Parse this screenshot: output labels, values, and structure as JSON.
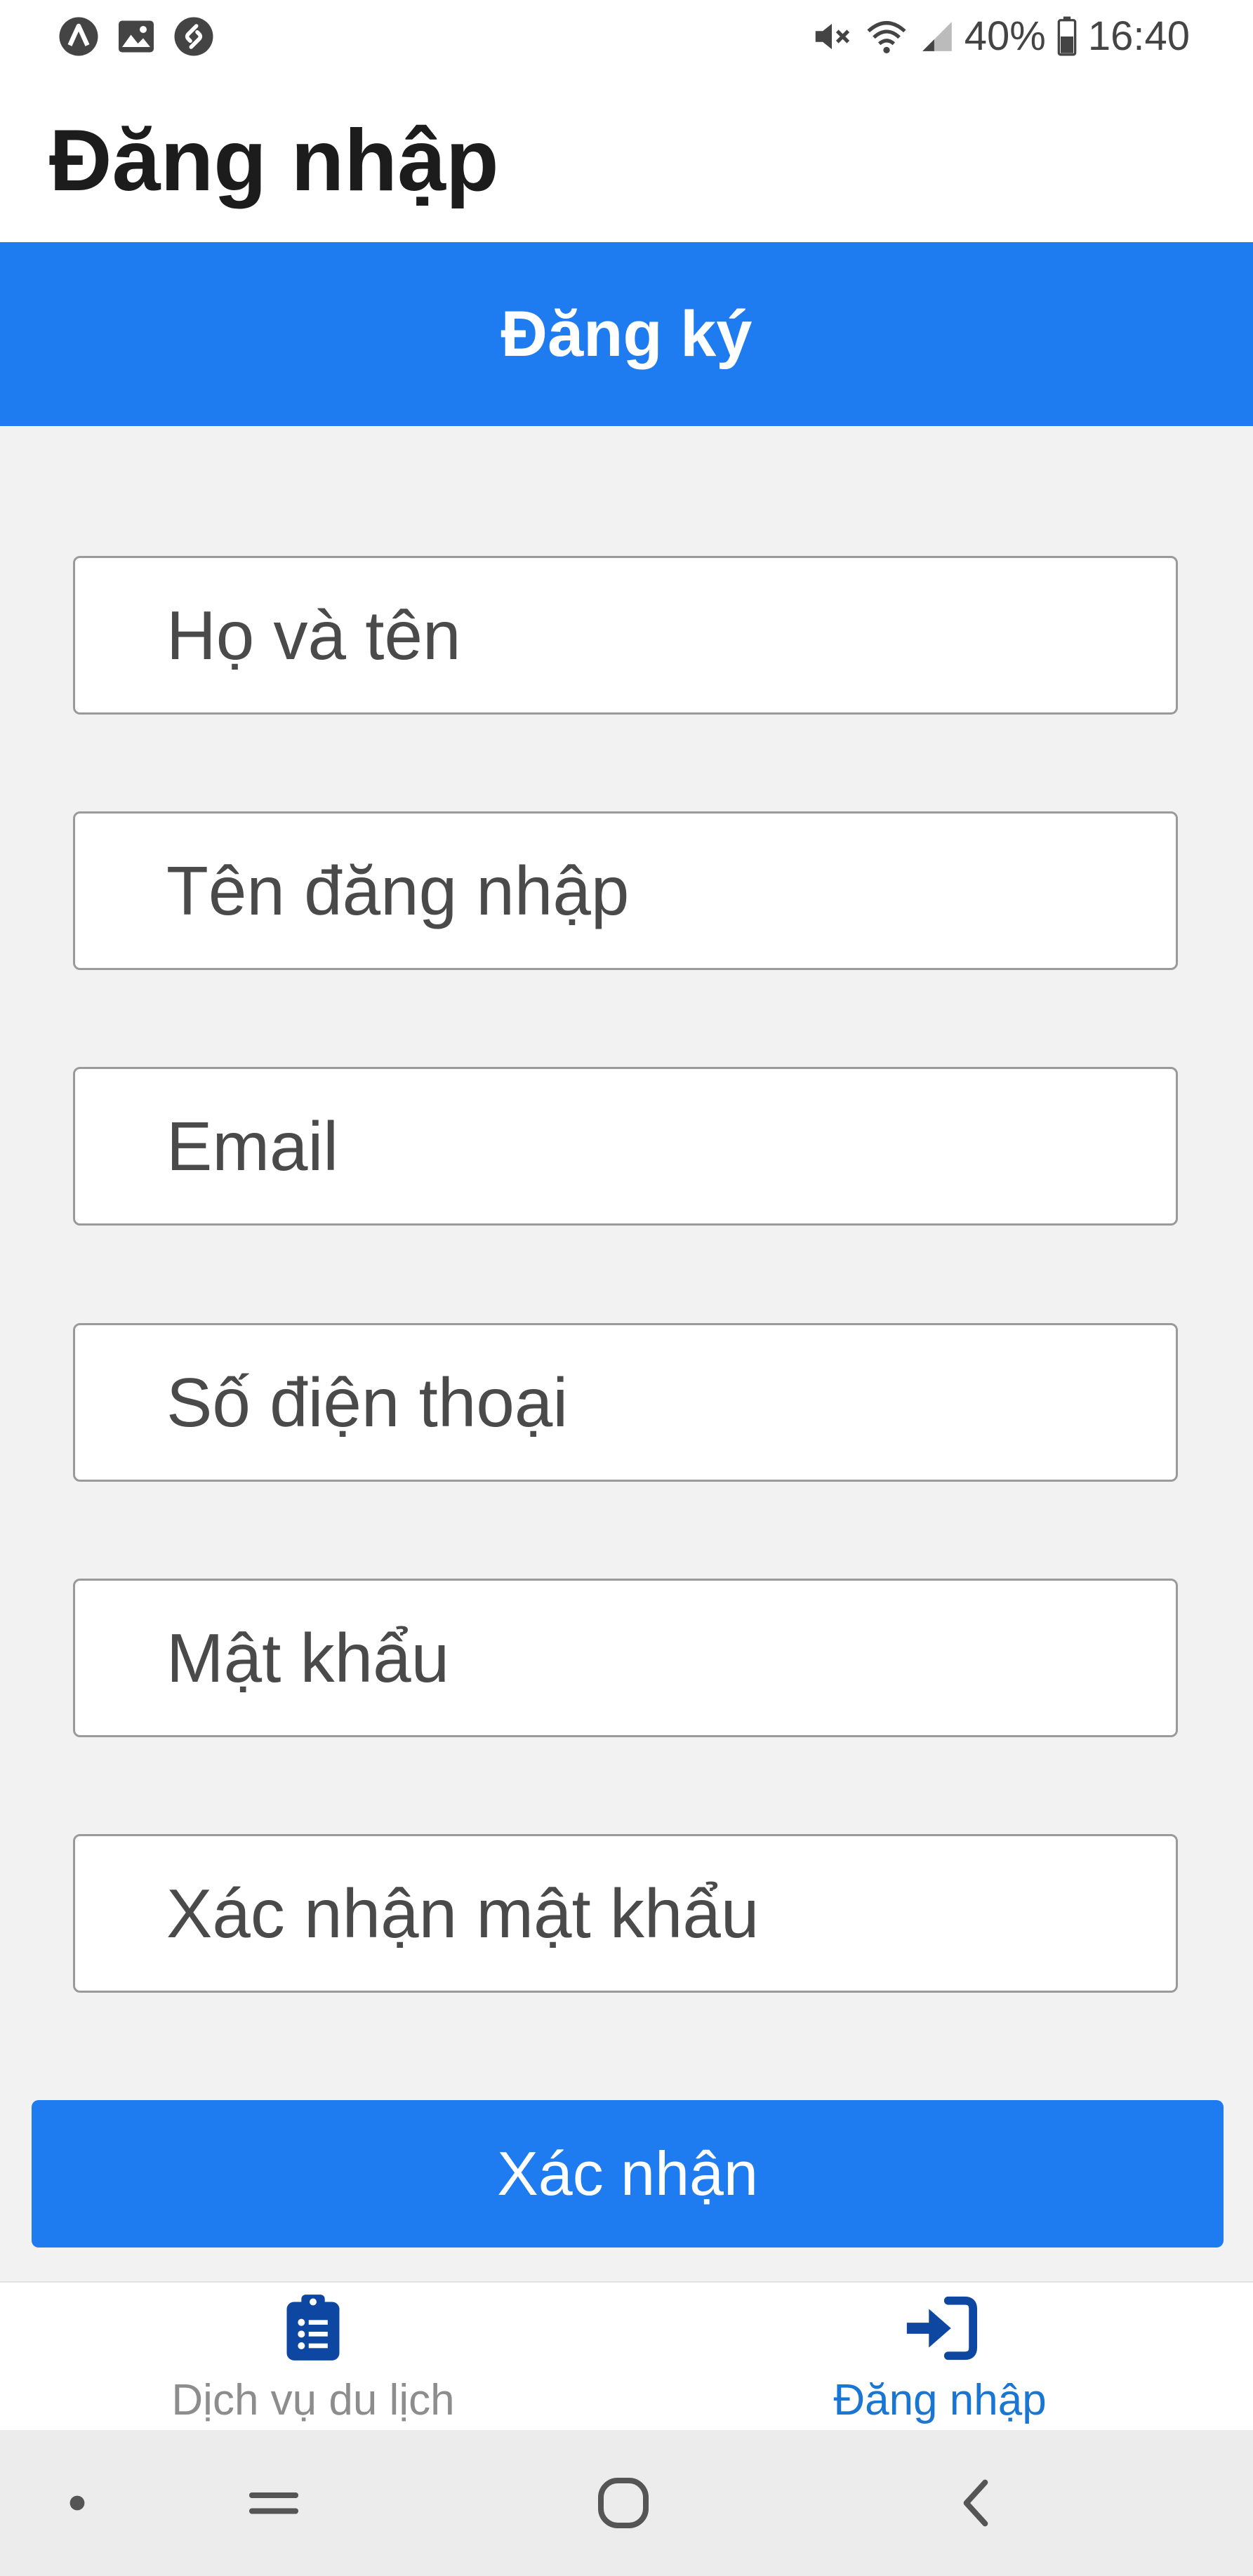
{
  "status_bar": {
    "left_icons": [
      "app-a-icon",
      "image-icon",
      "shazam-icon"
    ],
    "right_icons": [
      "mute-icon",
      "wifi-icon",
      "signal-icon",
      "battery-icon"
    ],
    "battery": "40%",
    "time": "16:40"
  },
  "header": {
    "title": "Đăng nhập"
  },
  "banner": {
    "title": "Đăng ký",
    "color": "#1e7cf0"
  },
  "form": {
    "fields": [
      {
        "placeholder": "Họ và tên",
        "value": ""
      },
      {
        "placeholder": "Tên đăng nhập",
        "value": ""
      },
      {
        "placeholder": "Email",
        "value": ""
      },
      {
        "placeholder": "Số điện thoại",
        "value": ""
      },
      {
        "placeholder": "Mật khẩu",
        "value": ""
      },
      {
        "placeholder": "Xác nhận mật khẩu",
        "value": ""
      }
    ],
    "submit_label": "Xác nhận"
  },
  "tabs": [
    {
      "label": "Dịch vụ du lịch",
      "icon": "clipboard-list-icon",
      "active": false
    },
    {
      "label": "Đăng nhập",
      "icon": "sign-in-icon",
      "active": true
    }
  ],
  "colors": {
    "accent": "#1e7cf0",
    "active_tab": "#1976d2",
    "inactive_tab": "#8d8d8d",
    "tab_icon": "#0d47a1"
  },
  "nav_bar": {
    "items": [
      "dot-icon",
      "recents-icon",
      "home-icon",
      "back-icon"
    ]
  }
}
